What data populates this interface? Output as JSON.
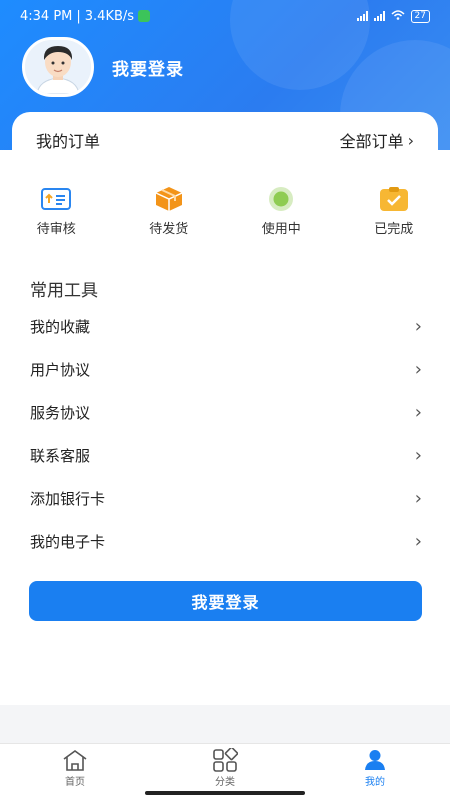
{
  "status_bar": {
    "time": "4:34 PM",
    "speed": "3.4KB/s",
    "battery": "27"
  },
  "profile": {
    "login_text": "我要登录"
  },
  "orders": {
    "title": "我的订单",
    "all_label": "全部订单",
    "items": [
      {
        "label": "待审核",
        "icon": "review-icon"
      },
      {
        "label": "待发货",
        "icon": "box-icon"
      },
      {
        "label": "使用中",
        "icon": "in-use-icon"
      },
      {
        "label": "已完成",
        "icon": "completed-icon"
      }
    ]
  },
  "tools": {
    "title": "常用工具",
    "items": [
      "我的收藏",
      "用户协议",
      "服务协议",
      "联系客服",
      "添加银行卡",
      "我的电子卡"
    ]
  },
  "login_button": "我要登录",
  "tabs": [
    {
      "label": "首页",
      "icon": "home-icon"
    },
    {
      "label": "分类",
      "icon": "category-icon"
    },
    {
      "label": "我的",
      "icon": "user-icon",
      "active": true
    }
  ],
  "colors": {
    "accent": "#1a7ff1",
    "header": "#1e8cff"
  }
}
